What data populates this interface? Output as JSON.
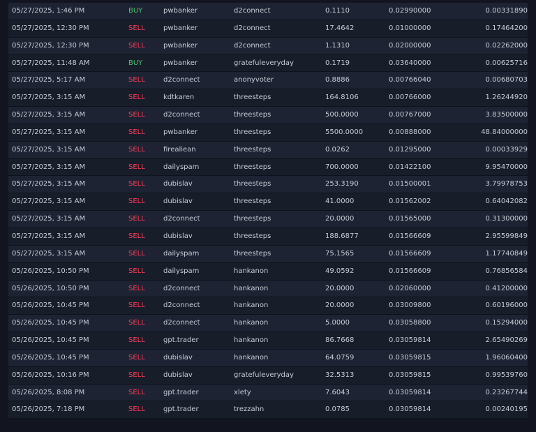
{
  "colors": {
    "buy": "#3fc46a",
    "sell": "#ff3d5a",
    "row_odd": "#1d2332",
    "row_even": "#181d2a",
    "background": "#121520",
    "text": "#c7ccd6"
  },
  "trades": [
    {
      "date": "05/27/2025, 1:46 PM",
      "type": "BUY",
      "buyer": "pwbanker",
      "seller": "d2connect",
      "amount": "0.1110",
      "price": "0.02990000",
      "total": "0.00331890"
    },
    {
      "date": "05/27/2025, 12:30 PM",
      "type": "SELL",
      "buyer": "pwbanker",
      "seller": "d2connect",
      "amount": "17.4642",
      "price": "0.01000000",
      "total": "0.17464200"
    },
    {
      "date": "05/27/2025, 12:30 PM",
      "type": "SELL",
      "buyer": "pwbanker",
      "seller": "d2connect",
      "amount": "1.1310",
      "price": "0.02000000",
      "total": "0.02262000"
    },
    {
      "date": "05/27/2025, 11:48 AM",
      "type": "BUY",
      "buyer": "pwbanker",
      "seller": "gratefuleveryday",
      "amount": "0.1719",
      "price": "0.03640000",
      "total": "0.00625716"
    },
    {
      "date": "05/27/2025, 5:17 AM",
      "type": "SELL",
      "buyer": "d2connect",
      "seller": "anonyvoter",
      "amount": "0.8886",
      "price": "0.00766040",
      "total": "0.00680703"
    },
    {
      "date": "05/27/2025, 3:15 AM",
      "type": "SELL",
      "buyer": "kdtkaren",
      "seller": "threesteps",
      "amount": "164.8106",
      "price": "0.00766000",
      "total": "1.26244920"
    },
    {
      "date": "05/27/2025, 3:15 AM",
      "type": "SELL",
      "buyer": "d2connect",
      "seller": "threesteps",
      "amount": "500.0000",
      "price": "0.00767000",
      "total": "3.83500000"
    },
    {
      "date": "05/27/2025, 3:15 AM",
      "type": "SELL",
      "buyer": "pwbanker",
      "seller": "threesteps",
      "amount": "5500.0000",
      "price": "0.00888000",
      "total": "48.84000000"
    },
    {
      "date": "05/27/2025, 3:15 AM",
      "type": "SELL",
      "buyer": "firealiean",
      "seller": "threesteps",
      "amount": "0.0262",
      "price": "0.01295000",
      "total": "0.00033929"
    },
    {
      "date": "05/27/2025, 3:15 AM",
      "type": "SELL",
      "buyer": "dailyspam",
      "seller": "threesteps",
      "amount": "700.0000",
      "price": "0.01422100",
      "total": "9.95470000"
    },
    {
      "date": "05/27/2025, 3:15 AM",
      "type": "SELL",
      "buyer": "dubislav",
      "seller": "threesteps",
      "amount": "253.3190",
      "price": "0.01500001",
      "total": "3.79978753"
    },
    {
      "date": "05/27/2025, 3:15 AM",
      "type": "SELL",
      "buyer": "dubislav",
      "seller": "threesteps",
      "amount": "41.0000",
      "price": "0.01562002",
      "total": "0.64042082"
    },
    {
      "date": "05/27/2025, 3:15 AM",
      "type": "SELL",
      "buyer": "d2connect",
      "seller": "threesteps",
      "amount": "20.0000",
      "price": "0.01565000",
      "total": "0.31300000"
    },
    {
      "date": "05/27/2025, 3:15 AM",
      "type": "SELL",
      "buyer": "dubislav",
      "seller": "threesteps",
      "amount": "188.6877",
      "price": "0.01566609",
      "total": "2.95599849"
    },
    {
      "date": "05/27/2025, 3:15 AM",
      "type": "SELL",
      "buyer": "dailyspam",
      "seller": "threesteps",
      "amount": "75.1565",
      "price": "0.01566609",
      "total": "1.17740849"
    },
    {
      "date": "05/26/2025, 10:50 PM",
      "type": "SELL",
      "buyer": "dailyspam",
      "seller": "hankanon",
      "amount": "49.0592",
      "price": "0.01566609",
      "total": "0.76856584"
    },
    {
      "date": "05/26/2025, 10:50 PM",
      "type": "SELL",
      "buyer": "d2connect",
      "seller": "hankanon",
      "amount": "20.0000",
      "price": "0.02060000",
      "total": "0.41200000"
    },
    {
      "date": "05/26/2025, 10:45 PM",
      "type": "SELL",
      "buyer": "d2connect",
      "seller": "hankanon",
      "amount": "20.0000",
      "price": "0.03009800",
      "total": "0.60196000"
    },
    {
      "date": "05/26/2025, 10:45 PM",
      "type": "SELL",
      "buyer": "d2connect",
      "seller": "hankanon",
      "amount": "5.0000",
      "price": "0.03058800",
      "total": "0.15294000"
    },
    {
      "date": "05/26/2025, 10:45 PM",
      "type": "SELL",
      "buyer": "gpt.trader",
      "seller": "hankanon",
      "amount": "86.7668",
      "price": "0.03059814",
      "total": "2.65490269"
    },
    {
      "date": "05/26/2025, 10:45 PM",
      "type": "SELL",
      "buyer": "dubislav",
      "seller": "hankanon",
      "amount": "64.0759",
      "price": "0.03059815",
      "total": "1.96060400"
    },
    {
      "date": "05/26/2025, 10:16 PM",
      "type": "SELL",
      "buyer": "dubislav",
      "seller": "gratefuleveryday",
      "amount": "32.5313",
      "price": "0.03059815",
      "total": "0.99539760"
    },
    {
      "date": "05/26/2025, 8:08 PM",
      "type": "SELL",
      "buyer": "gpt.trader",
      "seller": "xlety",
      "amount": "7.6043",
      "price": "0.03059814",
      "total": "0.23267744"
    },
    {
      "date": "05/26/2025, 7:18 PM",
      "type": "SELL",
      "buyer": "gpt.trader",
      "seller": "trezzahn",
      "amount": "0.0785",
      "price": "0.03059814",
      "total": "0.00240195"
    }
  ]
}
